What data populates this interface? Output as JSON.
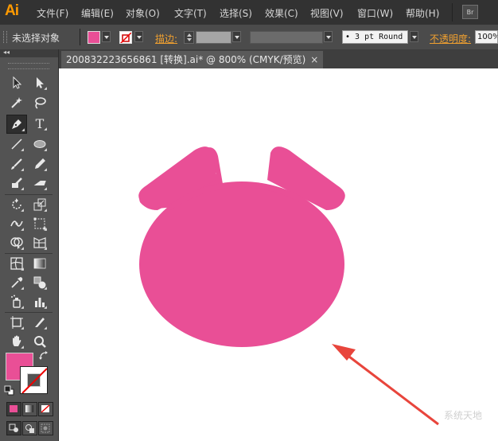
{
  "app": {
    "logo": "Ai",
    "bridge_label": "Br"
  },
  "menu": [
    {
      "label": "文件(F)"
    },
    {
      "label": "编辑(E)"
    },
    {
      "label": "对象(O)"
    },
    {
      "label": "文字(T)"
    },
    {
      "label": "选择(S)"
    },
    {
      "label": "效果(C)"
    },
    {
      "label": "视图(V)"
    },
    {
      "label": "窗口(W)"
    },
    {
      "label": "帮助(H)"
    }
  ],
  "control": {
    "selection_label": "未选择对象",
    "stroke_label": "描边:",
    "brush_value": "• 3 pt Round",
    "opacity_label": "不透明度:",
    "opacity_value": "100%"
  },
  "document": {
    "tab_title": "20083222365686​1 [转换].ai* @ 800% (CMYK/预览)",
    "close_glyph": "×"
  },
  "tools": {
    "type_glyph": "T",
    "collapse_glyph": "◂◂"
  },
  "colors": {
    "fill": "#e94f96",
    "annotation_arrow": "#e8453c",
    "ui_dark": "#323232",
    "accent_orange": "#ff9a00"
  },
  "watermark": "系统天地"
}
